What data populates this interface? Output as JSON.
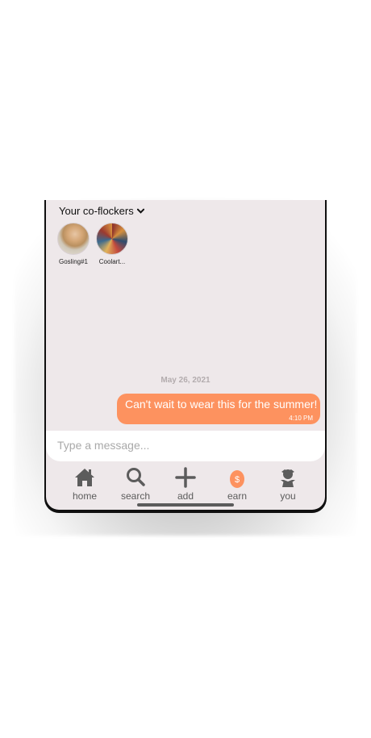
{
  "coflockers": {
    "title": "Your co-flockers",
    "members": [
      {
        "name": "Gosling#1"
      },
      {
        "name": "Coolart..."
      }
    ]
  },
  "chat": {
    "date": "May 26, 2021",
    "messages": [
      {
        "text": "Can't wait to wear this for the summer!",
        "time": "4:10 PM"
      }
    ]
  },
  "composer": {
    "placeholder": "Type a message..."
  },
  "tabs": [
    {
      "label": "home",
      "icon": "home-icon"
    },
    {
      "label": "search",
      "icon": "search-icon"
    },
    {
      "label": "add",
      "icon": "plus-icon"
    },
    {
      "label": "earn",
      "icon": "dollar-egg-icon"
    },
    {
      "label": "you",
      "icon": "person-icon"
    }
  ],
  "colors": {
    "accent": "#fd925f",
    "screen_bg": "#eee8ea",
    "tab_icon": "#5c5c5c"
  }
}
